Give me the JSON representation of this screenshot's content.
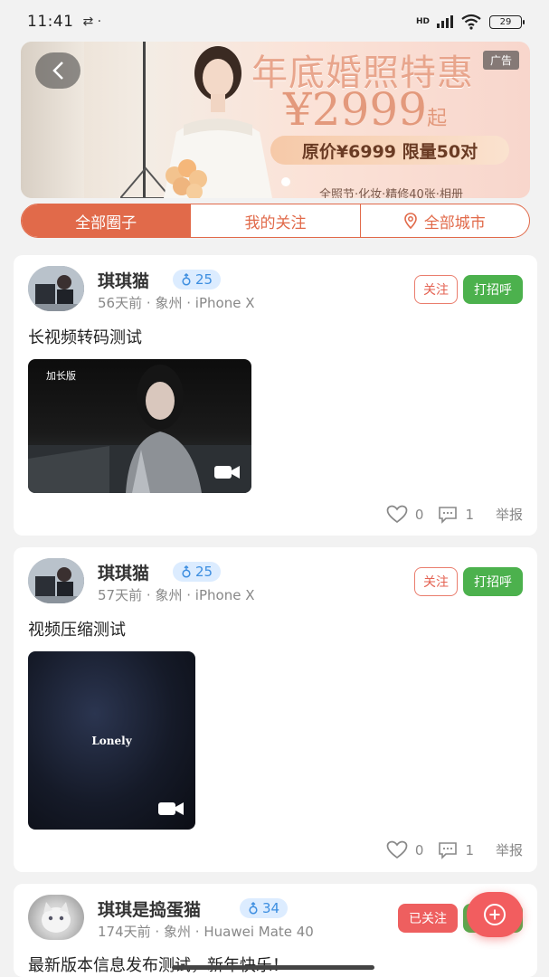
{
  "status_bar": {
    "time": "11:41",
    "left_icons": "⇄ ·",
    "network": "HD",
    "battery": "29"
  },
  "banner": {
    "ad_label": "广告",
    "headline": "年底婚照特惠",
    "price": "¥2999起",
    "price_suffix": "起",
    "price_main": "¥2999",
    "subline": "原价¥6999 限量50对",
    "detail": "全照节·化妆·精修40张·相册",
    "colors": {
      "accent": "#e8a58c"
    }
  },
  "tabs": [
    {
      "label": "全部圈子",
      "active": true
    },
    {
      "label": "我的关注",
      "active": false
    },
    {
      "label": "全部城市",
      "active": false,
      "icon": "location-pin-icon"
    }
  ],
  "posts": [
    {
      "username": "琪琪猫",
      "gender_icon": "male-icon",
      "age": "25",
      "time": "56天前",
      "city": "象州",
      "device": "iPhone X",
      "follow_label": "关注",
      "greet_label": "打招呼",
      "text": "长视频转码测试",
      "video_label": "加长版",
      "likes": "0",
      "comments": "1",
      "report_label": "举报"
    },
    {
      "username": "琪琪猫",
      "gender_icon": "male-icon",
      "age": "25",
      "time": "57天前",
      "city": "象州",
      "device": "iPhone X",
      "follow_label": "关注",
      "greet_label": "打招呼",
      "text": "视频压缩测试",
      "video_caption": "Lonely",
      "likes": "0",
      "comments": "1",
      "report_label": "举报"
    },
    {
      "username": "琪琪是捣蛋猫",
      "gender_icon": "male-icon",
      "age": "34",
      "time": "174天前",
      "city": "象州",
      "device": "Huawei Mate 40",
      "follow_label": "已关注",
      "text": "最新版本信息发布测试，新年快乐！"
    }
  ],
  "separator": "·",
  "fab": {
    "icon": "plus-icon"
  },
  "colors": {
    "primary": "#e16a4a",
    "green": "#4cb14d",
    "badge_blue": "#3d8ee0"
  }
}
